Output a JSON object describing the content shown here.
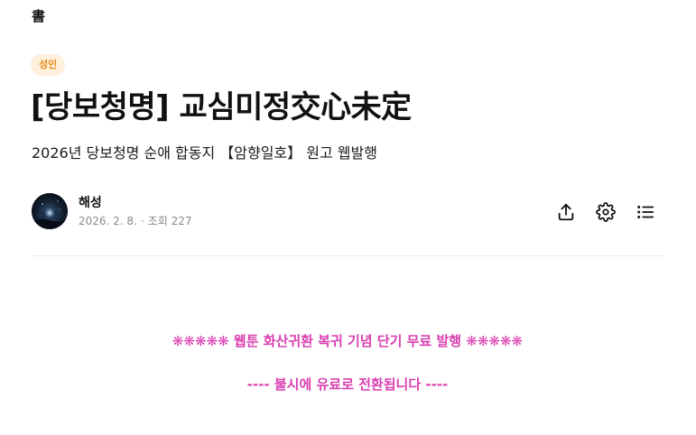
{
  "header": {
    "logo": "書"
  },
  "post": {
    "badge": "성인",
    "title": "[당보청명] 교심미정交心未定",
    "subtitle": "2026년 당보청명 순애 합동지 【암향일호】 원고 웹발행",
    "author": {
      "name": "해성",
      "date": "2026. 2. 8.",
      "separator": "·",
      "views": "조회 227"
    }
  },
  "toolbar": {
    "icons": [
      "share-icon",
      "settings-icon",
      "list-icon"
    ]
  },
  "body": {
    "notice_line1": "❋❋❋❋❋ 웹툰 화산귀환 복귀 기념 단기 무료 발행 ❋❋❋❋❋",
    "notice_line2": "---- 불시에 유료로 전환됩니다 ----"
  },
  "colors": {
    "badge_bg": "#fff0db",
    "badge_text": "#e8891c",
    "notice_text": "#d93fb0",
    "meta_text": "#8a8a8a"
  }
}
